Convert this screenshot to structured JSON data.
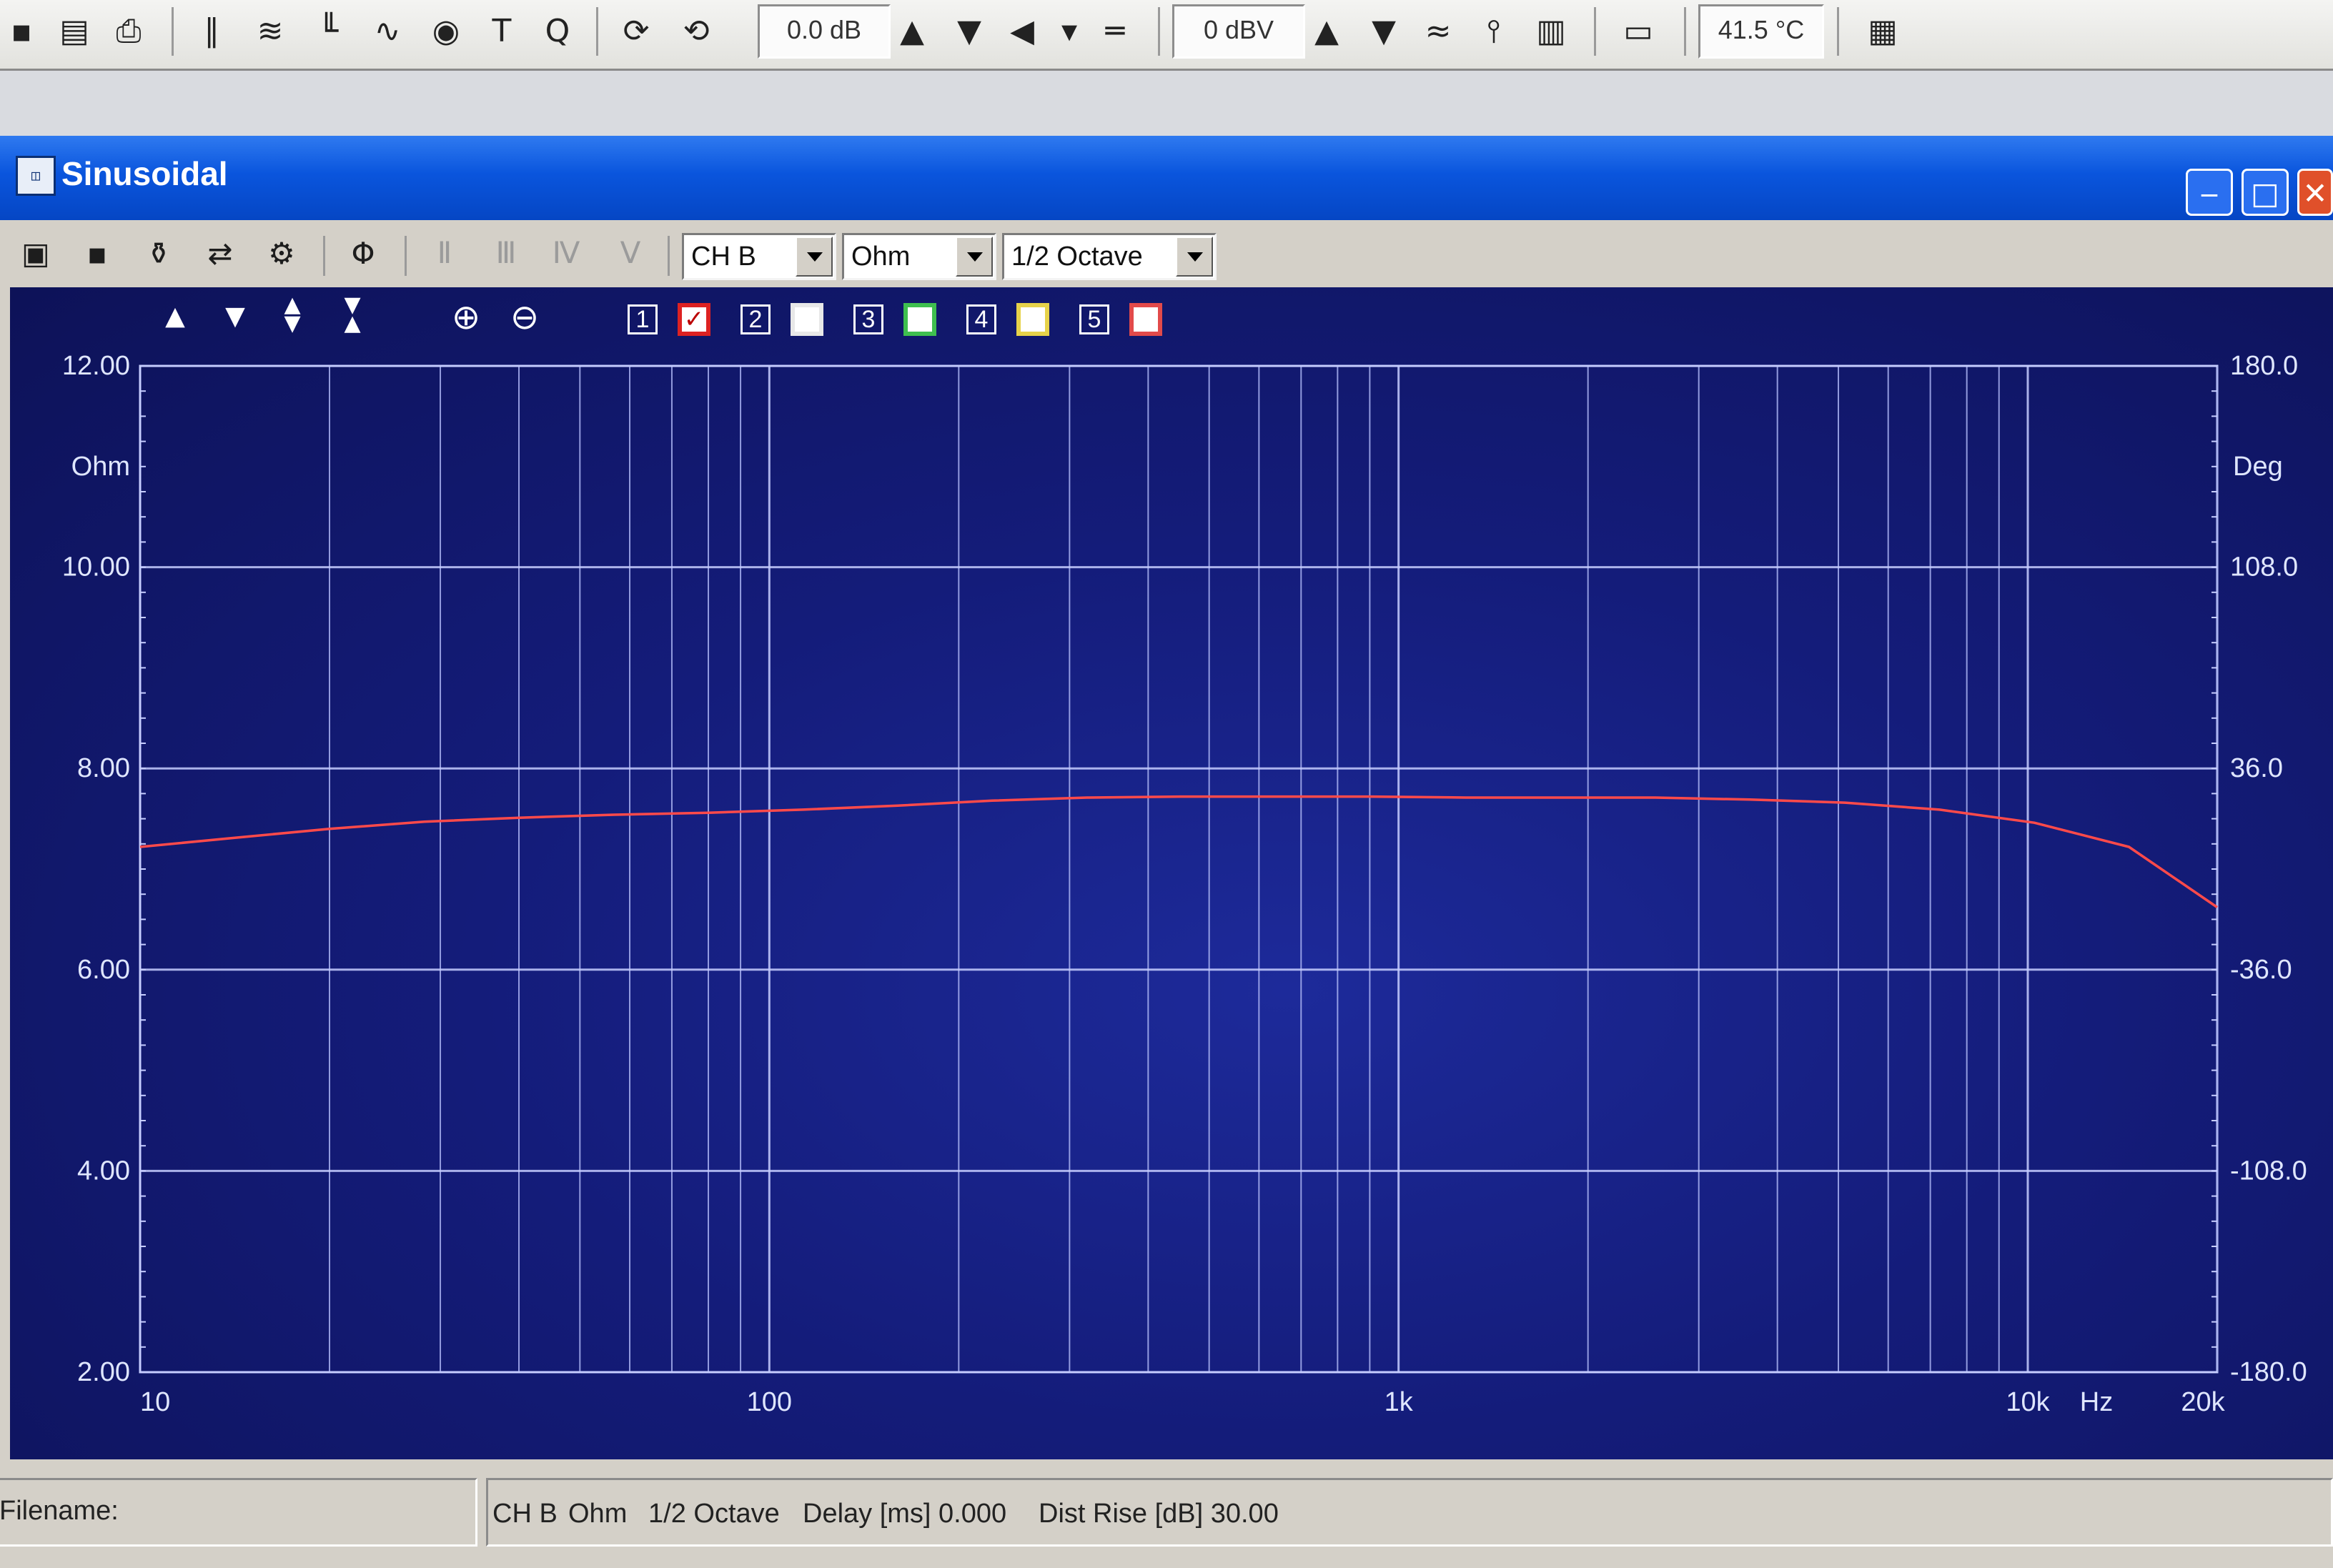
{
  "toolbar": {
    "level_db": "0.0 dB",
    "level_dbv": "0 dBV",
    "temperature": "41.5 °C"
  },
  "window": {
    "title": "Sinusoidal",
    "channel_select": "CH B",
    "unit_select": "Ohm",
    "resolution_select": "1/2 Octave"
  },
  "traces": [
    "1",
    "2",
    "3",
    "4",
    "5"
  ],
  "chart_data": {
    "type": "line",
    "x_scale": "log",
    "x": [
      10,
      14.1,
      20,
      28.3,
      40,
      56.6,
      80,
      113,
      160,
      226,
      320,
      453,
      640,
      905,
      1280,
      1810,
      2560,
      3620,
      5120,
      7240,
      10240,
      14480,
      20000
    ],
    "series": [
      {
        "values": [
          7.22,
          7.31,
          7.4,
          7.47,
          7.51,
          7.54,
          7.56,
          7.59,
          7.63,
          7.68,
          7.71,
          7.72,
          7.72,
          7.72,
          7.71,
          7.71,
          7.71,
          7.69,
          7.66,
          7.59,
          7.46,
          7.22,
          6.62
        ]
      }
    ],
    "ylim": [
      2,
      12
    ],
    "yticks": [
      "12.00",
      "10.00",
      "8.00",
      "6.00",
      "4.00",
      "2.00"
    ],
    "ylabel": "Ohm",
    "y2lim": [
      -180,
      180
    ],
    "y2ticks": [
      "180.0",
      "108.0",
      "36.0",
      "-36.0",
      "-108.0",
      "-180.0"
    ],
    "y2label": "Deg",
    "xtick_labels": [
      "10",
      "100",
      "1k",
      "10k",
      "20k"
    ],
    "xunit": "Hz",
    "grid": true,
    "line_color": "#ff4a4a"
  },
  "status": {
    "filename_label": "Filename:",
    "channel": "CH B",
    "unit": "Ohm",
    "resolution": "1/2 Octave",
    "delay": "Delay [ms] 0.000",
    "dist_rise": "Dist Rise [dB] 30.00"
  }
}
